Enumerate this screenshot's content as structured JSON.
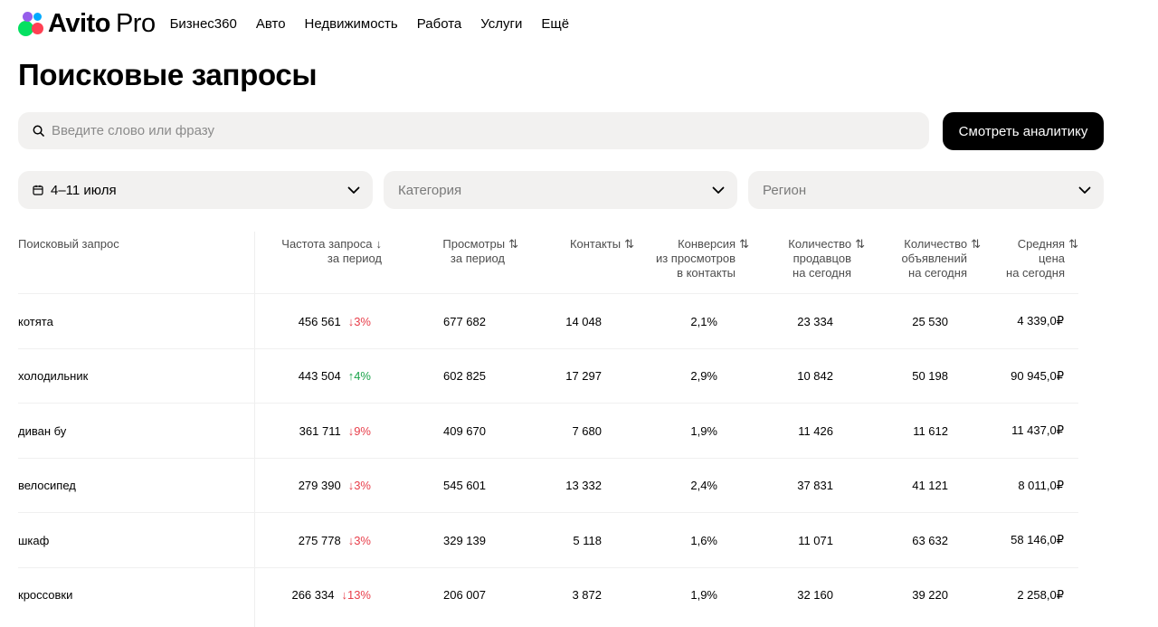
{
  "header": {
    "brand": "Avito",
    "brand_suffix": "Pro",
    "nav": [
      "Бизнес360",
      "Авто",
      "Недвижимость",
      "Работа",
      "Услуги",
      "Ещё"
    ]
  },
  "page": {
    "title": "Поисковые запросы"
  },
  "search": {
    "placeholder": "Введите слово или фразу",
    "value": ""
  },
  "actions": {
    "analytics_button": "Смотреть аналитику"
  },
  "filters": {
    "date": "4–11 июля",
    "category_placeholder": "Категория",
    "region_placeholder": "Регион"
  },
  "table": {
    "columns": [
      {
        "line1": "Поисковый запрос",
        "line2": "",
        "line3": ""
      },
      {
        "line1": "Частота запроса",
        "line2": "за период",
        "line3": ""
      },
      {
        "line1": "Просмотры",
        "line2": "за период",
        "line3": ""
      },
      {
        "line1": "Контакты",
        "line2": "",
        "line3": ""
      },
      {
        "line1": "Конверсия",
        "line2": "из просмотров",
        "line3": "в контакты"
      },
      {
        "line1": "Количество",
        "line2": "продавцов",
        "line3": "на сегодня"
      },
      {
        "line1": "Количество",
        "line2": "объявлений",
        "line3": "на сегодня"
      },
      {
        "line1": "Средняя",
        "line2": "цена",
        "line3": "на сегодня"
      }
    ],
    "rows": [
      {
        "query": "котята",
        "frequency": "456 561",
        "delta": "3%",
        "delta_dir": "down",
        "views": "677 682",
        "contacts": "14 048",
        "conversion": "2,1%",
        "sellers": "23 334",
        "listings": "25 530",
        "price": "4 339,0₽"
      },
      {
        "query": "холодильник",
        "frequency": "443 504",
        "delta": "4%",
        "delta_dir": "up",
        "views": "602 825",
        "contacts": "17 297",
        "conversion": "2,9%",
        "sellers": "10 842",
        "listings": "50 198",
        "price": "90 945,0₽"
      },
      {
        "query": "диван бу",
        "frequency": "361 711",
        "delta": "9%",
        "delta_dir": "down",
        "views": "409 670",
        "contacts": "7 680",
        "conversion": "1,9%",
        "sellers": "11 426",
        "listings": "11 612",
        "price": "11 437,0₽"
      },
      {
        "query": "велосипед",
        "frequency": "279 390",
        "delta": "3%",
        "delta_dir": "down",
        "views": "545 601",
        "contacts": "13 332",
        "conversion": "2,4%",
        "sellers": "37 831",
        "listings": "41 121",
        "price": "8 011,0₽"
      },
      {
        "query": "шкаф",
        "frequency": "275 778",
        "delta": "3%",
        "delta_dir": "down",
        "views": "329 139",
        "contacts": "5 118",
        "conversion": "1,6%",
        "sellers": "11 071",
        "listings": "63 632",
        "price": "58 146,0₽"
      },
      {
        "query": "кроссовки",
        "frequency": "266 334",
        "delta": "13%",
        "delta_dir": "down",
        "views": "206 007",
        "contacts": "3 872",
        "conversion": "1,9%",
        "sellers": "32 160",
        "listings": "39 220",
        "price": "2 258,0₽"
      }
    ]
  },
  "colors": {
    "delta_down": "#e8404c",
    "delta_up": "#1aa34a",
    "surface": "#f2f1f0",
    "primary_button": "#000000"
  },
  "icons": {
    "search": "search-icon",
    "calendar": "calendar-icon",
    "chevron": "chevron-down-icon",
    "sort": "sort-icon",
    "arrow_down": "arrow-down-icon",
    "arrow_up": "arrow-up-icon"
  }
}
